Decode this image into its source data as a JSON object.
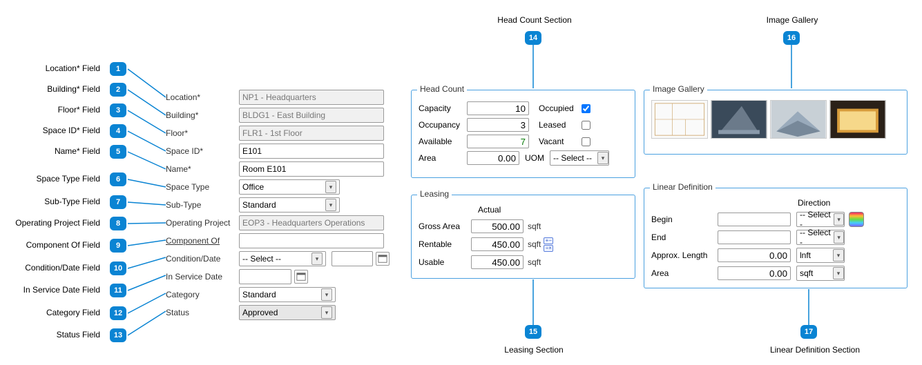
{
  "annotations": {
    "1": "Location* Field",
    "2": "Building* Field",
    "3": "Floor* Field",
    "4": "Space ID* Field",
    "5": "Name* Field",
    "6": "Space Type Field",
    "7": "Sub-Type Field",
    "8": "Operating Project Field",
    "9": "Component Of Field",
    "10": "Condition/Date Field",
    "11": "In Service Date Field",
    "12": "Category Field",
    "13": "Status Field",
    "14": "Head Count Section",
    "15": "Leasing Section",
    "16": "Image Gallery",
    "17": "Linear Definition Section"
  },
  "form": {
    "labels": {
      "location": "Location*",
      "building": "Building*",
      "floor": "Floor*",
      "space_id": "Space ID*",
      "name": "Name*",
      "space_type": "Space Type",
      "sub_type": "Sub-Type",
      "operating_project": "Operating Project",
      "component_of": "Component Of",
      "condition_date": "Condition/Date",
      "in_service_date": "In Service Date",
      "category": "Category",
      "status": "Status"
    },
    "values": {
      "location": "NP1 - Headquarters",
      "building": "BLDG1 - East Building",
      "floor": "FLR1 - 1st Floor",
      "space_id": "E101",
      "name": "Room E101",
      "space_type": "Office",
      "sub_type": "Standard",
      "operating_project": "EOP3 - Headquarters Operations",
      "component_of": "",
      "condition_select": "-- Select --",
      "condition_date": "",
      "in_service_date": "",
      "category": "Standard",
      "status": "Approved"
    }
  },
  "headcount": {
    "legend": "Head Count",
    "labels": {
      "capacity": "Capacity",
      "occupancy": "Occupancy",
      "available": "Available",
      "area": "Area",
      "occupied": "Occupied",
      "leased": "Leased",
      "vacant": "Vacant",
      "uom": "UOM"
    },
    "values": {
      "capacity": "10",
      "occupancy": "3",
      "available": "7",
      "area": "0.00",
      "uom": "-- Select --"
    },
    "checks": {
      "occupied": true,
      "leased": false,
      "vacant": false
    }
  },
  "leasing": {
    "legend": "Leasing",
    "actual_header": "Actual",
    "labels": {
      "gross": "Gross Area",
      "rentable": "Rentable",
      "usable": "Usable"
    },
    "values": {
      "gross": "500.00",
      "rentable": "450.00",
      "usable": "450.00"
    },
    "units": {
      "sqft": "sqft"
    }
  },
  "gallery": {
    "legend": "Image Gallery"
  },
  "linear": {
    "legend": "Linear Definition",
    "direction_header": "Direction",
    "labels": {
      "begin": "Begin",
      "end": "End",
      "approx": "Approx. Length",
      "area": "Area"
    },
    "selects": {
      "begin_dir": "-- Select -",
      "end_dir": "-- Select -"
    },
    "values": {
      "begin": "",
      "end": "",
      "approx": "0.00",
      "area": "0.00"
    },
    "units": {
      "lnft": "lnft",
      "sqft": "sqft"
    }
  }
}
